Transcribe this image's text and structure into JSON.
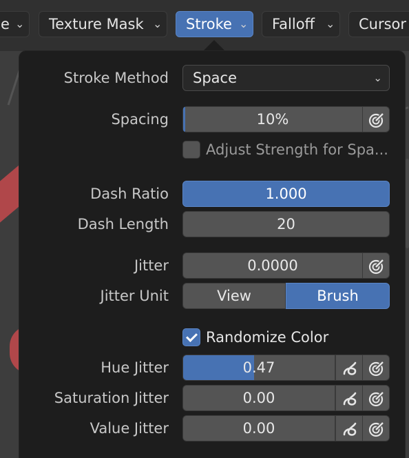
{
  "header": {
    "tabs": [
      {
        "label": "e",
        "active": false
      },
      {
        "label": "Texture Mask",
        "active": false
      },
      {
        "label": "Stroke",
        "active": true
      },
      {
        "label": "Falloff",
        "active": false
      },
      {
        "label": "Cursor",
        "active": false
      }
    ]
  },
  "stroke": {
    "stroke_method_label": "Stroke Method",
    "stroke_method_value": "Space",
    "spacing_label": "Spacing",
    "spacing_value": "10%",
    "adjust_strength_label": "Adjust Strength for Spa...",
    "adjust_strength_checked": false,
    "dash_ratio_label": "Dash Ratio",
    "dash_ratio_value": "1.000",
    "dash_length_label": "Dash Length",
    "dash_length_value": "20",
    "jitter_label": "Jitter",
    "jitter_value": "0.0000",
    "jitter_unit_label": "Jitter Unit",
    "jitter_unit_options": [
      "View",
      "Brush"
    ],
    "jitter_unit_selected": "Brush",
    "randomize_color_label": "Randomize Color",
    "randomize_color_checked": true,
    "hue_jitter_label": "Hue Jitter",
    "hue_jitter_value": "0.47",
    "hue_jitter_fraction": 0.47,
    "saturation_jitter_label": "Saturation Jitter",
    "saturation_jitter_value": "0.00",
    "value_jitter_label": "Value Jitter",
    "value_jitter_value": "0.00"
  },
  "icons": {
    "pressure": "pen-pressure-icon",
    "random": "random-icon"
  },
  "colors": {
    "accent": "#4772b3",
    "panel": "#1d1d1d",
    "field": "#545454"
  }
}
